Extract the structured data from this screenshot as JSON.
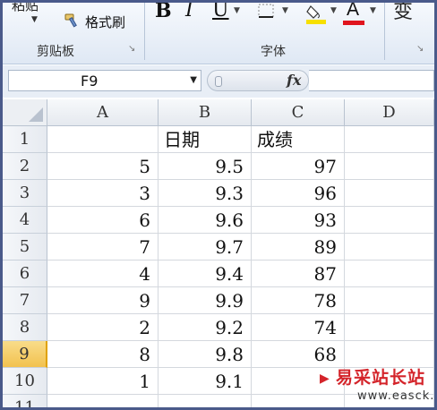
{
  "ribbon": {
    "clipboard_top_partial": "粘贴",
    "format_painter_label": "格式刷",
    "clipboard_group_label": "剪贴板",
    "bold_label": "B",
    "italic_label": "I",
    "underline_label": "U",
    "font_color_label": "A",
    "font_group_label": "字体",
    "wen_partial": "变",
    "fill_color": "#f7e000",
    "font_color": "#e0141e",
    "icons": [
      "paintbrush-icon",
      "dropdown-arrow-icon",
      "dialog-launcher-icon",
      "borders-icon",
      "fill-bucket-icon"
    ]
  },
  "formula_bar": {
    "name_box_value": "F9",
    "fx_label": "fx",
    "formula_value": ""
  },
  "sheet": {
    "columns": [
      "A",
      "B",
      "C",
      "D"
    ],
    "rows": [
      {
        "num": "1",
        "a": "",
        "b": "日期",
        "c": "成绩",
        "d": ""
      },
      {
        "num": "2",
        "a": "5",
        "b": "9.5",
        "c": "97",
        "d": ""
      },
      {
        "num": "3",
        "a": "3",
        "b": "9.3",
        "c": "96",
        "d": ""
      },
      {
        "num": "4",
        "a": "6",
        "b": "9.6",
        "c": "93",
        "d": ""
      },
      {
        "num": "5",
        "a": "7",
        "b": "9.7",
        "c": "89",
        "d": ""
      },
      {
        "num": "6",
        "a": "4",
        "b": "9.4",
        "c": "87",
        "d": ""
      },
      {
        "num": "7",
        "a": "9",
        "b": "9.9",
        "c": "78",
        "d": ""
      },
      {
        "num": "8",
        "a": "2",
        "b": "9.2",
        "c": "74",
        "d": ""
      },
      {
        "num": "9",
        "a": "8",
        "b": "9.8",
        "c": "68",
        "d": ""
      },
      {
        "num": "10",
        "a": "1",
        "b": "9.1",
        "c": "",
        "d": ""
      },
      {
        "num": "11",
        "a": "",
        "b": "",
        "c": "",
        "d": ""
      }
    ],
    "selected_row": "9",
    "selection_color": "#f2c24f"
  },
  "watermark": {
    "title": "易采站长站",
    "url": "www.easck.com"
  }
}
